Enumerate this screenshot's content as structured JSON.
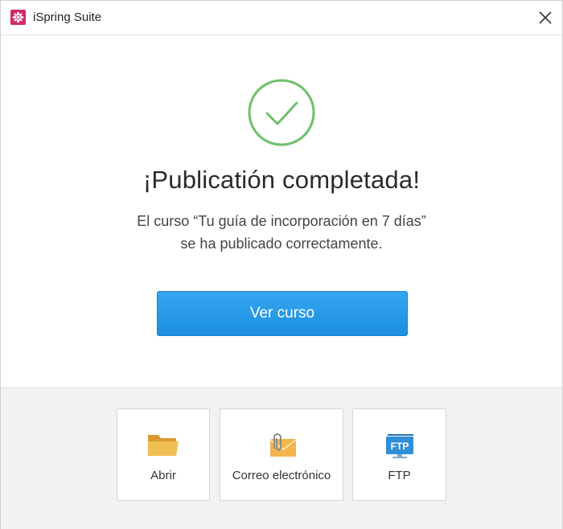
{
  "window": {
    "title": "iSpring Suite",
    "logo_icon": "ispring-logo-icon",
    "close_icon": "close-icon"
  },
  "status": {
    "icon": "checkmark-circle-icon",
    "color": "#6cc06a",
    "headline": "¡Publicatión completada!",
    "message_line1": "El curso “Tu guía de incorporación en 7 días”",
    "message_line2": "se ha publicado correctamente."
  },
  "primary_action": {
    "label": "Ver curso",
    "color": "#1f93e4"
  },
  "footer": {
    "options": [
      {
        "label": "Abrir",
        "icon": "folder-icon"
      },
      {
        "label": "Correo electrónico",
        "icon": "email-attachment-icon"
      },
      {
        "label": "FTP",
        "icon": "ftp-icon",
        "icon_text": "FTP"
      }
    ]
  }
}
